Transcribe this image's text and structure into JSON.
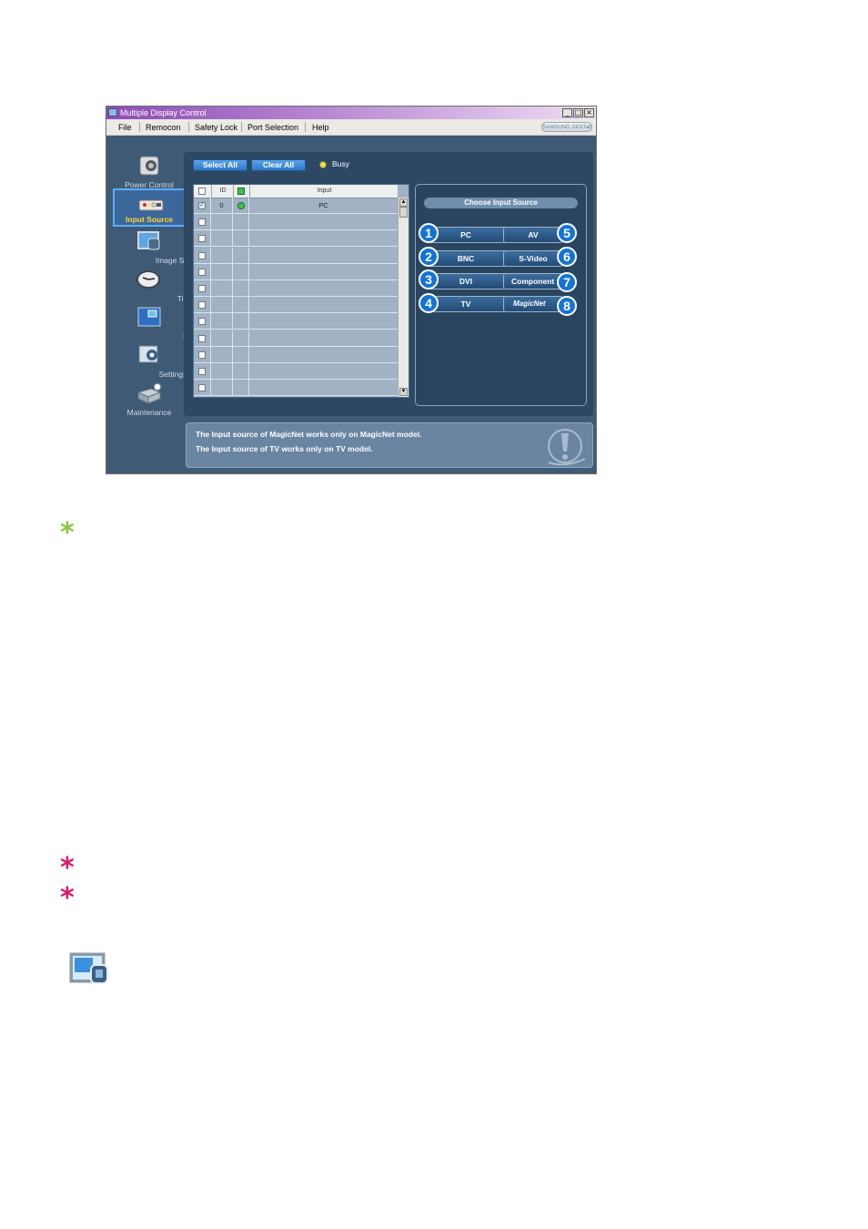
{
  "window": {
    "title": "Multiple Display Control",
    "menu": [
      "File",
      "Remocon",
      "Safety Lock",
      "Port Selection",
      "Help"
    ],
    "brand": "SAMSUNG DIGITall"
  },
  "sidebar": {
    "items": [
      {
        "label": "Power Control",
        "icon": "power-control-icon"
      },
      {
        "label": "Input Source",
        "icon": "input-source-icon",
        "active": true
      },
      {
        "label": "Image Size",
        "icon": "image-size-icon"
      },
      {
        "label": "Time",
        "icon": "time-icon"
      },
      {
        "label": "PIP",
        "icon": "pip-icon"
      },
      {
        "label": "Settings",
        "icon": "settings-icon"
      },
      {
        "label": "Maintenance",
        "icon": "maintenance-icon"
      }
    ]
  },
  "toolbar": {
    "select_all": "Select All",
    "clear_all": "Clear All",
    "busy": "Busy"
  },
  "grid": {
    "header": {
      "id": "ID",
      "input": "Input"
    },
    "rows": [
      {
        "checked": true,
        "id": "0",
        "status": "ok",
        "input": "PC"
      },
      {
        "checked": false,
        "id": "",
        "input": ""
      },
      {
        "checked": false,
        "id": "",
        "input": ""
      },
      {
        "checked": false,
        "id": "",
        "input": ""
      },
      {
        "checked": false,
        "id": "",
        "input": ""
      },
      {
        "checked": false,
        "id": "",
        "input": ""
      },
      {
        "checked": false,
        "id": "",
        "input": ""
      },
      {
        "checked": false,
        "id": "",
        "input": ""
      },
      {
        "checked": false,
        "id": "",
        "input": ""
      },
      {
        "checked": false,
        "id": "",
        "input": ""
      },
      {
        "checked": false,
        "id": "",
        "input": ""
      },
      {
        "checked": false,
        "id": "",
        "input": ""
      }
    ]
  },
  "sources": {
    "heading": "Choose Input Source",
    "buttons": [
      {
        "num": "1",
        "label": "PC"
      },
      {
        "num": "2",
        "label": "BNC"
      },
      {
        "num": "3",
        "label": "DVI"
      },
      {
        "num": "4",
        "label": "TV"
      },
      {
        "num": "5",
        "label": "AV"
      },
      {
        "num": "6",
        "label": "S-Video"
      },
      {
        "num": "7",
        "label": "Component"
      },
      {
        "num": "8",
        "label": "MagicNet"
      }
    ]
  },
  "info": {
    "line1": "The Input source of MagicNet works only on MagicNet model.",
    "line2": "The Input source of TV works only on TV  model."
  },
  "colors": {
    "note_green": "#8dc63f",
    "note_red": "#e2156b",
    "accent_blue": "#1474d6"
  }
}
